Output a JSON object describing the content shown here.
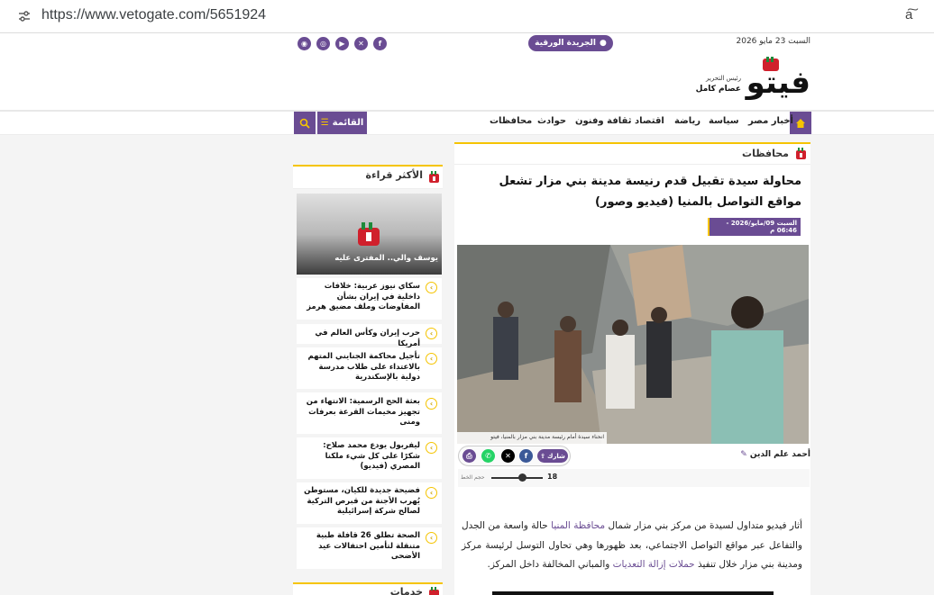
{
  "browser": {
    "url": "https://www.vetogate.com/5651924",
    "tune_icon": "tune-icon",
    "read_aloud_icon": "read-aloud-icon",
    "read_aloud_glyph": "a͠"
  },
  "top_bar": {
    "date": "السبت 23 مايو 2026",
    "paper_label": "الجريدة الورقية",
    "social_icons": [
      "facebook-icon",
      "x-icon",
      "youtube-icon",
      "instagram-icon",
      "rss-icon"
    ],
    "social_glyphs": [
      "f",
      "✕",
      "▶",
      "◎",
      "◉"
    ]
  },
  "header": {
    "logo_text": "فيتو",
    "editor_label": "رئيس التحرير",
    "editor_name": "عصام كامل"
  },
  "nav": {
    "items": [
      "أخبار مصر",
      "سياسة",
      "رياضة",
      "اقتصاد",
      "ثقافة وفنون",
      "حوادث",
      "محافظات"
    ],
    "menu_label": "القائمة",
    "menu_glyph": "☰",
    "home_icon": "home-icon",
    "search_icon": "search-icon"
  },
  "article": {
    "section": "محافظات",
    "title": "محاولة سيدة تقبيل قدم رنيسة مدينة بني مزار تشعل مواقع التواصل بالمنيا (فيديو وصور)",
    "date": "السبت 09/مايو/2026 - 06:46 م",
    "photo_caption": "انحناء سيدة أمام رئيسة مدينة بني مزار بالمنيا، فيتو",
    "author": "أحمد علم الدين",
    "share_label": "شارك",
    "share_icons": [
      "whatsapp-icon",
      "x-icon",
      "facebook-icon",
      "print-icon"
    ],
    "share_glyphs": [
      "✆",
      "✕",
      "f",
      "⎙"
    ],
    "share_colors": [
      "#25d366",
      "#000000",
      "#3b5998",
      "#6a4c93"
    ],
    "fontsize_label": "حجم الخط",
    "fontsize_value": "18",
    "body": {
      "p1_a": "أثار فيديو متداول لسيدة من مركز بني مزار شمال ",
      "link1": "محافظة المنيا",
      "p1_b": " حالة واسعة من الجدل والتفاعل عبر مواقع التواصل الاجتماعي، بعد ظهورها وهي تحاول التوسل لرئيسة مركز ومدينة بني مزار خلال تنفيذ ",
      "link2": "حملات إزالة التعديات",
      "p1_c": " والمباني المخالفة داخل المركز."
    }
  },
  "sidebar": {
    "most_read_title": "الأكثر قراءة",
    "featured_title": "يوسف والي.. المفترى عليه",
    "items": [
      "سكاي نيوز عربية: خلافات داخلية في إيران بشأن المفاوضات وملف مضيق هرمز",
      "حرب إيران وكأس العالم في أمريكا",
      "تأجيل محاكمة الجنايني المتهم بالاعتداء على طلاب مدرسة دولية بالإسكندرية",
      "بعثة الحج الرسمية: الانتهاء من تجهيز مخيمات القرعة بعرفات ومنى",
      "ليفربول يودع محمد صلاح: شكرًا على كل شيء ملكنا المصري (فيديو)",
      "فضيحة جديدة للكيان، مستوطن يُهرب الأجنة من قبرص التركية لصالح شركة إسرائيلية",
      "الصحة تطلق 26 قافلة طبية متنقلة لتأمين احتفالات عيد الأضحى"
    ],
    "item_icon": "chevron-left-icon",
    "item_glyph": "‹",
    "services_title": "خدمات"
  },
  "colors": {
    "brand_purple": "#6a4c93",
    "accent_yellow": "#f5c400",
    "logo_red": "#d0202c"
  }
}
